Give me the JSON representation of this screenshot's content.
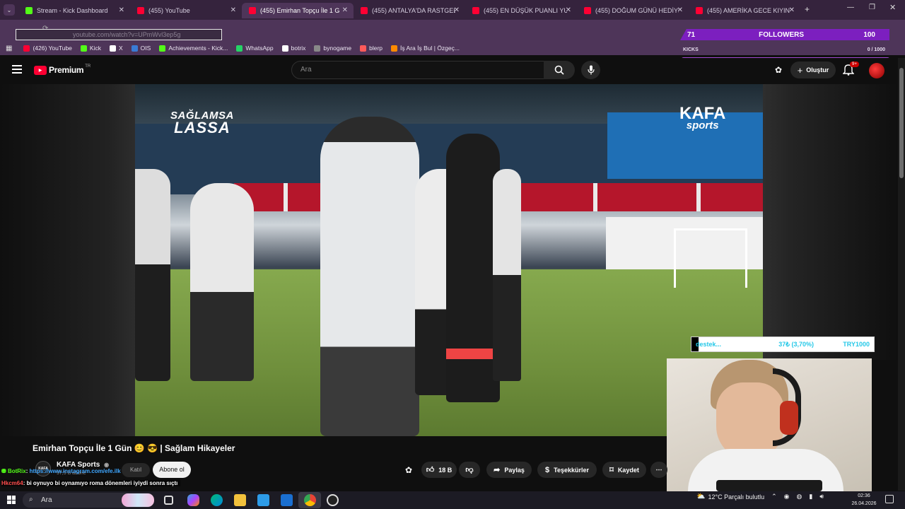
{
  "browser": {
    "tabs": [
      {
        "title": "Stream - Kick Dashboard",
        "favicon_color": "#53fc18",
        "active": false
      },
      {
        "title": "(455) YouTube",
        "favicon_color": "#ff0033",
        "active": false
      },
      {
        "title": "(455) Emirhan Topçu İle 1 G",
        "favicon_color": "#ff0033",
        "active": true
      },
      {
        "title": "(455) ANTALYA'DA RASTGELE M",
        "favicon_color": "#ff0033",
        "active": false
      },
      {
        "title": "(455) EN DÜŞÜK PUANLI YURT",
        "favicon_color": "#ff0033",
        "active": false
      },
      {
        "title": "(455) DOĞUM GÜNÜ HEDİYELİ",
        "favicon_color": "#ff0033",
        "active": false
      },
      {
        "title": "(455) AMERİKA GECE KIYINTISI",
        "favicon_color": "#ff0033",
        "active": false
      }
    ],
    "new_tab_label": "+",
    "address": "youtube.com/watch?v=UPmWvl3ep5g",
    "bookmarks": [
      {
        "label": "(426) YouTube",
        "color": "#ff0033"
      },
      {
        "label": "Kick",
        "color": "#53fc18"
      },
      {
        "label": "X",
        "color": "#ffffff"
      },
      {
        "label": "OIS",
        "color": "#3a7bd5"
      },
      {
        "label": "Achievements - Kick...",
        "color": "#53fc18"
      },
      {
        "label": "WhatsApp",
        "color": "#25d366"
      },
      {
        "label": "botrix",
        "color": "#ffffff"
      },
      {
        "label": "bynogame",
        "color": "#888888"
      },
      {
        "label": "blerp",
        "color": "#ff5a5a"
      },
      {
        "label": "İş Ara İş Bul | Özgeç...",
        "color": "#ff8a00"
      }
    ]
  },
  "overlay": {
    "followers_count": "71",
    "followers_label": "FOLLOWERS",
    "followers_goal": "100",
    "kicks_label": "KICKS",
    "kicks_progress": "0 / 1000",
    "donation": {
      "label": "destek...",
      "progress": "37₺ (3,70%)",
      "goal": "TRY1000",
      "fraction": 0.037
    }
  },
  "youtube": {
    "logo_text": "Premium",
    "region": "TR",
    "search_placeholder": "Ara",
    "create_label": "Oluştur",
    "notifications_badge": "9+",
    "video": {
      "brand_left_1": "SAĞLAMSA",
      "brand_left_2": "LASSA",
      "brand_right_1": "KAFA",
      "brand_right_2": "sports"
    },
    "title": "Emirhan Topçu İle 1 Gün 😊 😎 | Sağlam Hikayeler",
    "channel": "KAFA Sports",
    "channel_avatar": "KAFA",
    "subscribers": "97,5 B abone",
    "join_label": "Katıl",
    "subscribe_label": "Abone ol",
    "likes": "18 B",
    "share_label": "Paylaş",
    "thanks_label": "Teşekkürler",
    "save_label": "Kaydet",
    "more_label": "⋯"
  },
  "chat": [
    {
      "user": "BotRix",
      "user_color": "#53fc18",
      "message": "https://www.instagram.com/efe.ilk",
      "message_color": "#3ea6ff"
    },
    {
      "user": "Hkcm64",
      "user_color": "#ff4d4d",
      "message": "bi oynuyo bi oynamıyo roma dönemleri iyiydi sonra sıçtı",
      "message_color": "#ffffff"
    }
  ],
  "taskbar": {
    "search_placeholder": "Ara",
    "weather": "12°C  Parçalı bulutlu",
    "time": "02:36",
    "date": "26.04.2026"
  }
}
